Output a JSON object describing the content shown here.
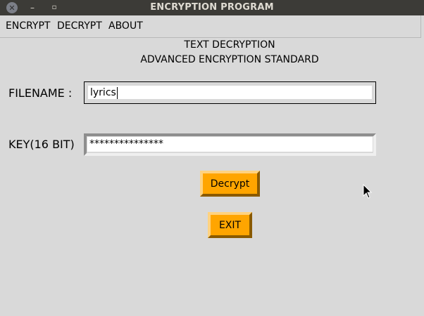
{
  "window": {
    "title": "ENCRYPTION PROGRAM"
  },
  "menu": {
    "items": [
      {
        "label": "ENCRYPT"
      },
      {
        "label": "DECRYPT"
      },
      {
        "label": "ABOUT"
      }
    ]
  },
  "main": {
    "heading1": "TEXT DECRYPTION",
    "heading2": "ADVANCED ENCRYPTION STANDARD",
    "filename_label": "FILENAME :",
    "filename_value": "lyrics",
    "key_label": "KEY(16 BIT)",
    "key_value": "***************",
    "decrypt_label": "Decrypt",
    "exit_label": "EXIT"
  },
  "colors": {
    "window_bg": "#d9d9d9",
    "titlebar_bg": "#3c3b37",
    "button_bg": "#ffa500"
  },
  "icons": [
    "close-icon",
    "minimize-icon",
    "maximize-icon",
    "mouse-pointer-icon"
  ]
}
